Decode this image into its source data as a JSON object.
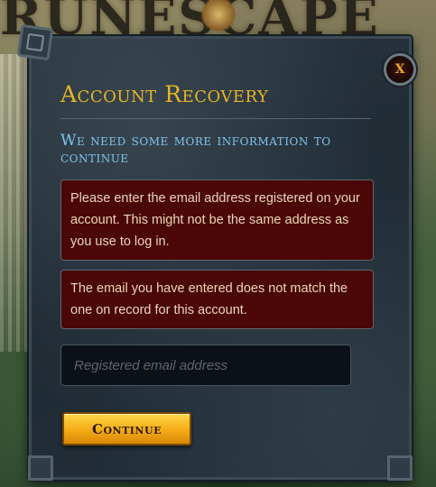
{
  "background": {
    "logo_text": "RUNESCAPE"
  },
  "dialog": {
    "close_label": "X",
    "title": "Account Recovery",
    "subtitle": "We need some more information to continue",
    "alerts": [
      {
        "text": "Please enter the email address registered on your account. This might not be the same address as you use to log in."
      },
      {
        "text": "The email you have entered does not match the one on record for this account."
      }
    ],
    "email_input": {
      "value": "",
      "placeholder": "Registered email address"
    },
    "continue_label": "Continue"
  },
  "colors": {
    "title_gold": "#e7b526",
    "subtitle_blue": "#7fc3ea",
    "alert_bg": "#4a0705",
    "button_gold": "#f4ab16"
  },
  "icons": {
    "close": "close-icon"
  }
}
